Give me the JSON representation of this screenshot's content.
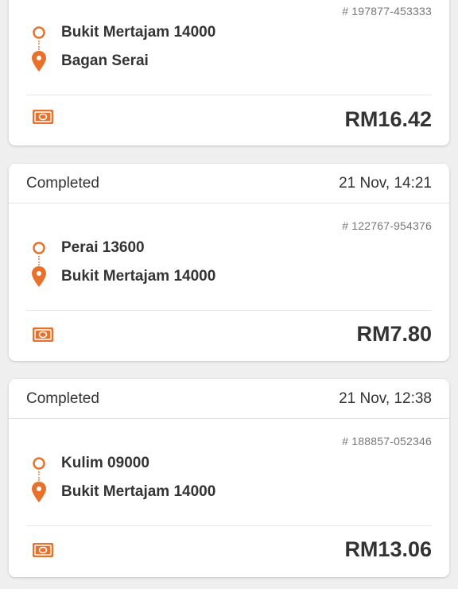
{
  "colors": {
    "accent": "#e8722c",
    "background": "#efefef",
    "card": "#ffffff",
    "text": "#333333",
    "muted": "#777777"
  },
  "orders": [
    {
      "status": "",
      "datetime": "",
      "order_id": "# 197877-453333",
      "pickup": "Bukit Mertajam 14000",
      "dropoff": "Bagan Serai",
      "amount": "RM16.42",
      "payment_icon": "cash-icon"
    },
    {
      "status": "Completed",
      "datetime": "21 Nov, 14:21",
      "order_id": "# 122767-954376",
      "pickup": "Perai 13600",
      "dropoff": "Bukit Mertajam 14000",
      "amount": "RM7.80",
      "payment_icon": "cash-icon"
    },
    {
      "status": "Completed",
      "datetime": "21 Nov, 12:38",
      "order_id": "# 188857-052346",
      "pickup": "Kulim 09000",
      "dropoff": "Bukit Mertajam 14000",
      "amount": "RM13.06",
      "payment_icon": "cash-icon"
    }
  ]
}
